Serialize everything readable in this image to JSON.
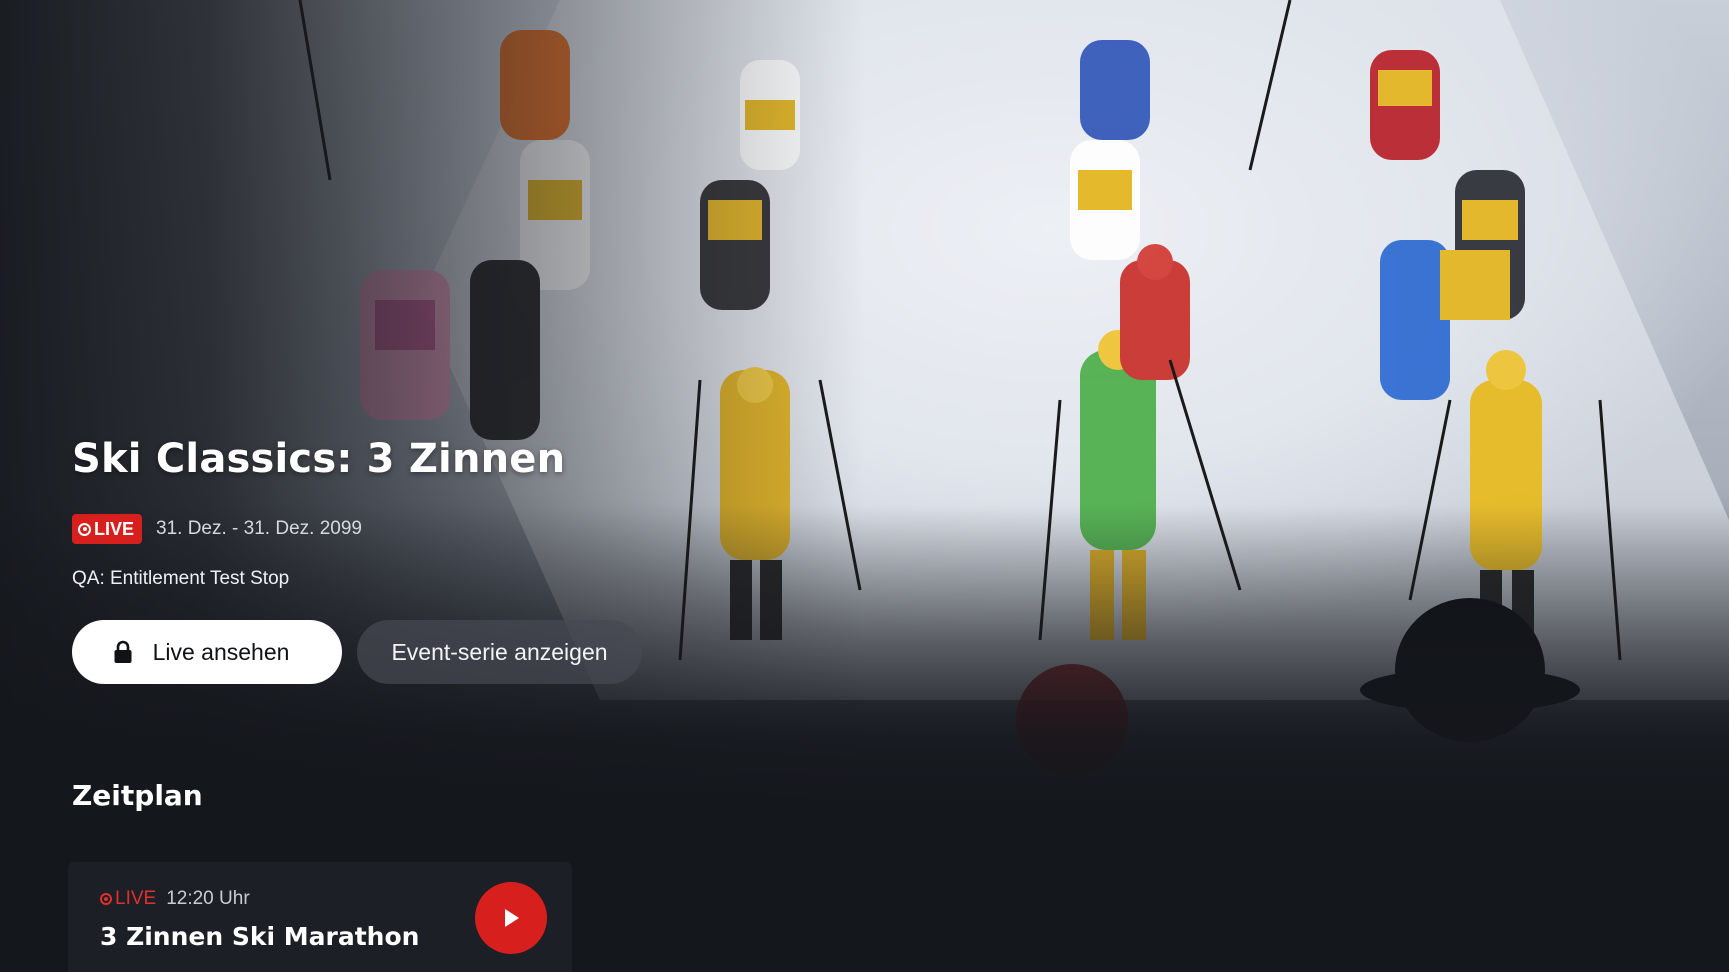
{
  "event": {
    "title": "Ski Classics: 3 Zinnen",
    "live_label": "LIVE",
    "date_range": "31. Dez. - 31. Dez. 2099",
    "subtitle": "QA: Entitlement Test Stop"
  },
  "actions": {
    "primary_label": "Live ansehen",
    "primary_icon": "lock-icon",
    "secondary_label": "Event-serie anzeigen"
  },
  "schedule": {
    "heading": "Zeitplan",
    "items": [
      {
        "live_label": "LIVE",
        "time": "12:20 Uhr",
        "title": "3 Zinnen Ski Marathon",
        "action_icon": "play-icon"
      }
    ]
  },
  "colors": {
    "accent": "#d7201e",
    "background": "#14171c",
    "card": "#1c1f25"
  }
}
